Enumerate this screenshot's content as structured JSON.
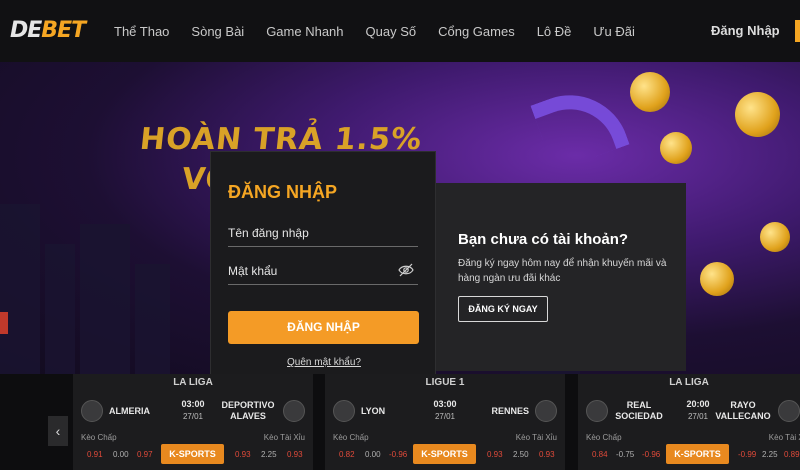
{
  "header": {
    "logo_de": "DE",
    "logo_bet": "BET",
    "menu": [
      "Thể Thao",
      "Sòng Bài",
      "Game Nhanh",
      "Quay Số",
      "Cổng Games",
      "Lô Đề",
      "Ưu Đãi"
    ],
    "login_label": "Đăng Nhập",
    "accent": "#f5a623"
  },
  "banner": {
    "line1": "HOÀN TRẢ 1.5%",
    "line2": "VỚ"
  },
  "login": {
    "title": "ĐĂNG NHẬP",
    "username_label": "Tên đăng nhập",
    "password_label": "Mật khẩu",
    "submit_label": "ĐĂNG NHẬP",
    "forgot_label": "Quên mật khẩu?",
    "icon": "eye-off-icon"
  },
  "register": {
    "title": "Bạn chưa có tài khoản?",
    "description": "Đăng ký ngay hôm nay để nhận khuyến mãi và hàng ngàn ưu đãi khác",
    "button_label": "ĐĂNG KÝ NGAY"
  },
  "matches": [
    {
      "league": "LA LIGA",
      "home": "ALMERIA",
      "away": "DEPORTIVO ALAVES",
      "time": "03:00",
      "date": "27/01",
      "handicap_label": "Kèo Chấp",
      "overunder_label": "Kèo Tài Xỉu",
      "odds_left": [
        "0.91",
        "0.00",
        "0.97"
      ],
      "odds_right": [
        "0.93",
        "2.25",
        "0.93"
      ],
      "provider": "K-SPORTS"
    },
    {
      "league": "LIGUE 1",
      "home": "LYON",
      "away": "RENNES",
      "time": "03:00",
      "date": "27/01",
      "handicap_label": "Kèo Chấp",
      "overunder_label": "Kèo Tài Xỉu",
      "odds_left": [
        "0.82",
        "0.00",
        "-0.96"
      ],
      "odds_right": [
        "0.93",
        "2.50",
        "0.93"
      ],
      "provider": "K-SPORTS"
    },
    {
      "league": "LA LIGA",
      "home": "REAL SOCIEDAD",
      "away": "RAYO VALLECANO",
      "time": "20:00",
      "date": "27/01",
      "handicap_label": "Kèo Chấp",
      "overunder_label": "Kèo Tài Xỉu",
      "odds_left": [
        "0.84",
        "-0.75",
        "-0.96"
      ],
      "odds_right": [
        "-0.99",
        "2.25",
        "0.89"
      ],
      "provider": "K-SPORTS"
    }
  ]
}
